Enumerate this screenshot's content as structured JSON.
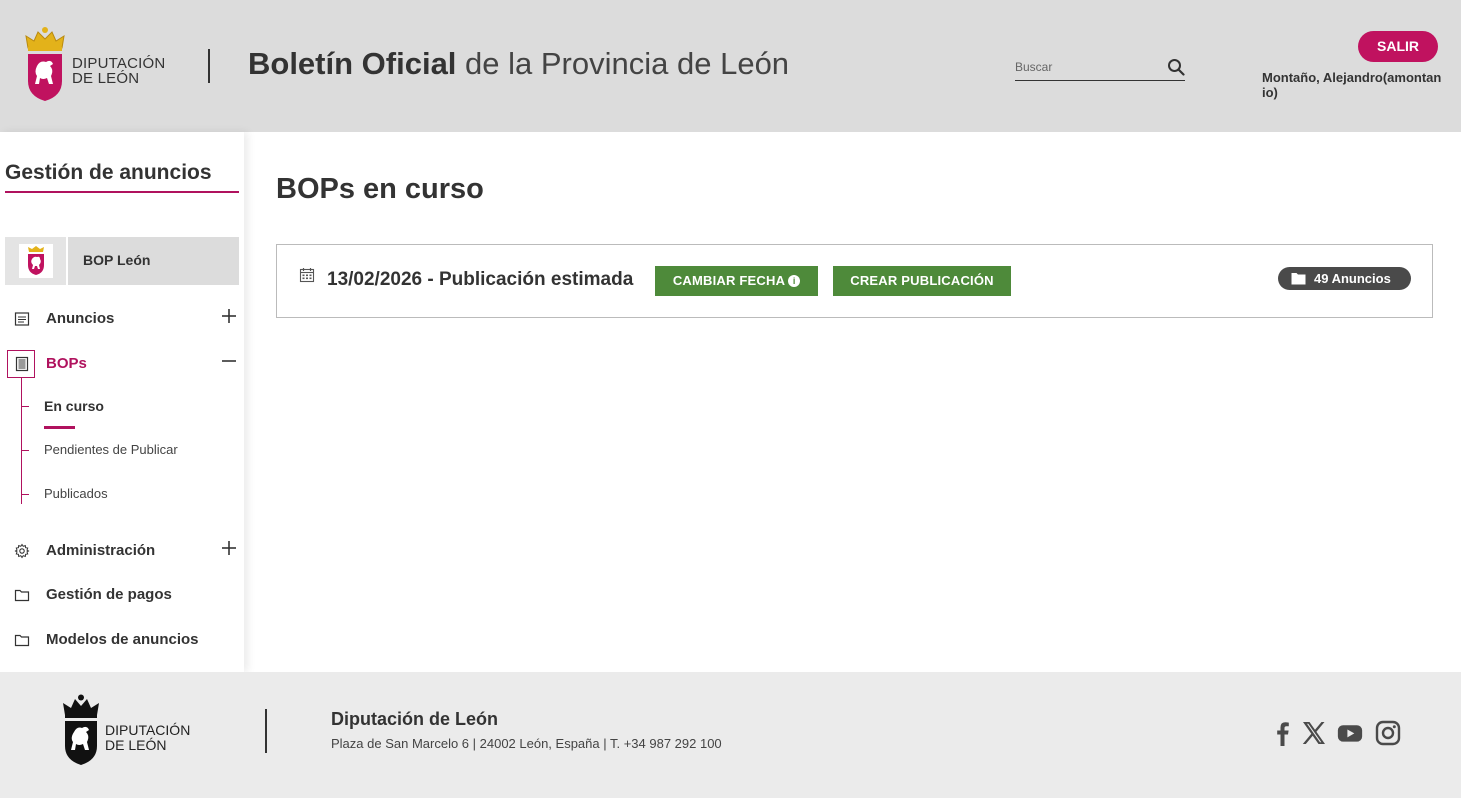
{
  "header": {
    "logo_text_line1": "DIPUTACIÓN",
    "logo_text_line2": "DE LEÓN",
    "title_bold": "Boletín Oficial",
    "title_light": "de la Provincia de León",
    "search_placeholder": "Buscar",
    "logout_label": "SALIR",
    "username": "Montaño, Alejandro(amontanio)"
  },
  "sidebar": {
    "title": "Gestión de anuncios",
    "bop_card_label": "BOP León",
    "items": [
      {
        "label": "Anuncios",
        "icon": "document-icon",
        "toggle": "plus"
      },
      {
        "label": "BOPs",
        "icon": "newspaper-icon",
        "toggle": "minus"
      },
      {
        "label": "Administración",
        "icon": "gear-icon",
        "toggle": "plus"
      },
      {
        "label": "Gestión de pagos",
        "icon": "folder-icon"
      },
      {
        "label": "Modelos de anuncios",
        "icon": "folder-icon"
      }
    ],
    "bops_subitems": [
      {
        "label": "En curso"
      },
      {
        "label": "Pendientes de Publicar"
      },
      {
        "label": "Publicados"
      }
    ]
  },
  "main": {
    "page_title": "BOPs en curso",
    "publication": {
      "date_text": "13/02/2026 - Publicación estimada",
      "change_date_label": "CAMBIAR FECHA",
      "create_label": "CREAR PUBLICACIÓN",
      "count_label": "49 Anuncios"
    }
  },
  "footer": {
    "org_name": "Diputación de León",
    "address": "Plaza de San Marcelo 6 | 24002 León, España | T. +34 987 292 100",
    "social": [
      "facebook-icon",
      "x-icon",
      "youtube-icon",
      "instagram-icon"
    ]
  },
  "colors": {
    "brand_magenta": "#c0125f",
    "action_green": "#4e8a3a",
    "header_bg": "#dcdcdc",
    "footer_bg": "#ebebeb"
  }
}
